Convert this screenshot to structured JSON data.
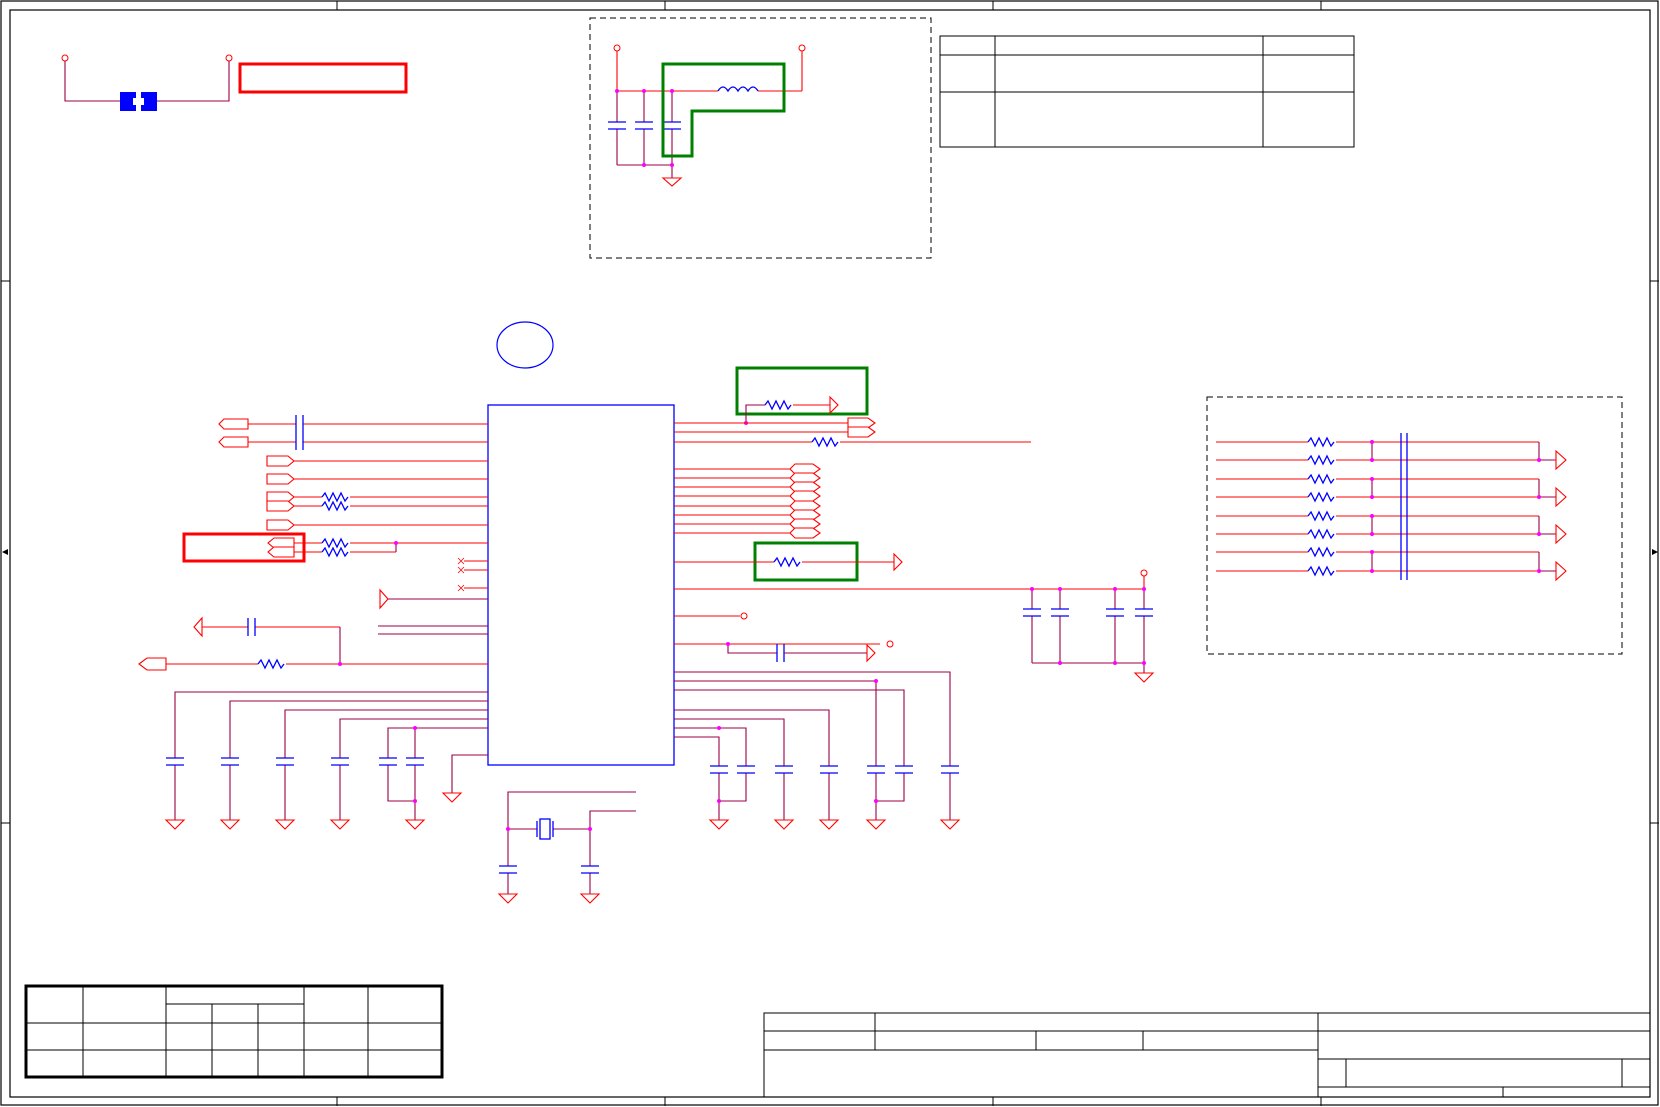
{
  "sheet": {
    "title_block_text": "",
    "revision_table_text": "",
    "grid_labels": []
  },
  "colors": {
    "wire": "#ff0000",
    "net": "#9b0046",
    "component": "#0000ff",
    "junction": "#ff00ff",
    "highlight_red": "#ff0000",
    "highlight_green": "#008000",
    "border": "#000000"
  }
}
